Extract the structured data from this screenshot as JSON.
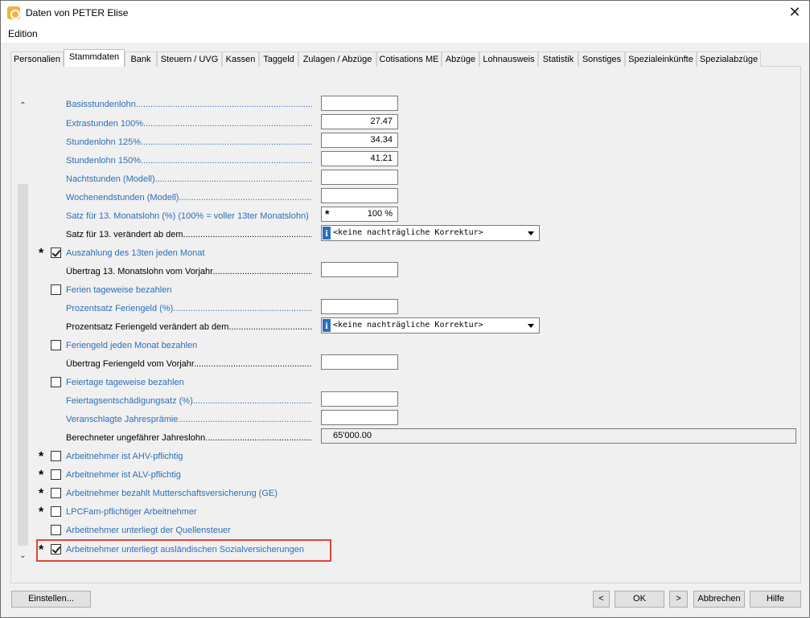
{
  "window": {
    "title": "Daten von PETER Elise",
    "close_glyph": "✕"
  },
  "menu": {
    "items": [
      "Edition"
    ]
  },
  "tabs": [
    "Personalien",
    "Stammdaten",
    "Bank",
    "Steuern / UVG",
    "Kassen",
    "Taggeld",
    "Zulagen / Abzüge",
    "Cotisations ME",
    "Abzüge",
    "Lohnausweis",
    "Statistik",
    "Sonstiges",
    "Spezialeinkünfte",
    "Spezialabzüge"
  ],
  "active_tab": "Stammdaten",
  "scroll": {
    "up": "⌃",
    "down": "⌄"
  },
  "fields": {
    "basis": {
      "label": "Basisstundenlohn",
      "value": ""
    },
    "extra100": {
      "label": "Extrastunden 100%",
      "value": "27.47"
    },
    "std125": {
      "label": "Stundenlohn 125%",
      "value": "34.34"
    },
    "std150": {
      "label": "Stundenlohn 150%",
      "value": "41.21"
    },
    "nacht": {
      "label": "Nachtstunden (Modell)",
      "value": ""
    },
    "wochenende": {
      "label": "Wochenendstunden (Modell)",
      "value": ""
    },
    "satz13": {
      "label": "Satz für 13. Monatslohn (%) (100% = voller 13ter Monatslohn)",
      "value": "100 %",
      "star": "*"
    },
    "satz13_changed": {
      "label": "Satz für 13. verändert ab dem",
      "select": "<keine nachträgliche Korrektur>",
      "info": "i"
    },
    "auszahlung13": {
      "label": "Auszahlung des 13ten jeden Monat",
      "checked": true,
      "star": "*"
    },
    "uebertrag13": {
      "label": "Übertrag 13. Monatslohn vom Vorjahr",
      "value": ""
    },
    "ferien_tageweise": {
      "label": "Ferien tageweise bezahlen",
      "checked": false
    },
    "prozent_feriengeld": {
      "label": "Prozentsatz Feriengeld (%)",
      "value": ""
    },
    "prozent_feriengeld_changed": {
      "label": "Prozentsatz Feriengeld verändert ab dem",
      "select": "<keine nachträgliche Korrektur>",
      "info": "i"
    },
    "feriengeld_monat": {
      "label": "Feriengeld jeden Monat bezahlen",
      "checked": false
    },
    "uebertrag_feriengeld": {
      "label": "Übertrag Feriengeld vom Vorjahr",
      "value": ""
    },
    "feiertage_tageweise": {
      "label": "Feiertage tageweise bezahlen",
      "checked": false
    },
    "feiertag_satz": {
      "label": "Feiertagsentschädigungsatz (%)",
      "value": ""
    },
    "jahrespraemie": {
      "label": "Veranschlagte Jahresprämie",
      "value": ""
    },
    "jahreslohn": {
      "label": "Berechneter ungefährer Jahreslohn",
      "value": "65'000.00"
    },
    "ahv": {
      "label": "Arbeitnehmer ist AHV-pflichtig",
      "checked": false,
      "star": "*"
    },
    "alv": {
      "label": "Arbeitnehmer ist ALV-pflichtig",
      "checked": false,
      "star": "*"
    },
    "mutterschaft": {
      "label": "Arbeitnehmer bezahlt Mutterschaftsversicherung (GE)",
      "checked": false,
      "star": "*"
    },
    "lpcfam": {
      "label": "LPCFam-pflichtiger Arbeitnehmer",
      "checked": false,
      "star": "*"
    },
    "quellensteuer": {
      "label": "Arbeitnehmer unterliegt der Quellensteuer",
      "checked": false
    },
    "ausland_sozial": {
      "label": "Arbeitnehmer unterliegt ausländischen Sozialversicherungen",
      "checked": true,
      "star": "*"
    }
  },
  "buttons": {
    "einstellen": "Einstellen...",
    "prev": "<",
    "ok": "OK",
    "next": ">",
    "abbrechen": "Abbrechen",
    "hilfe": "Hilfe"
  },
  "colors": {
    "link_blue": "#2e6eb8",
    "highlight_red": "#e0453a"
  }
}
